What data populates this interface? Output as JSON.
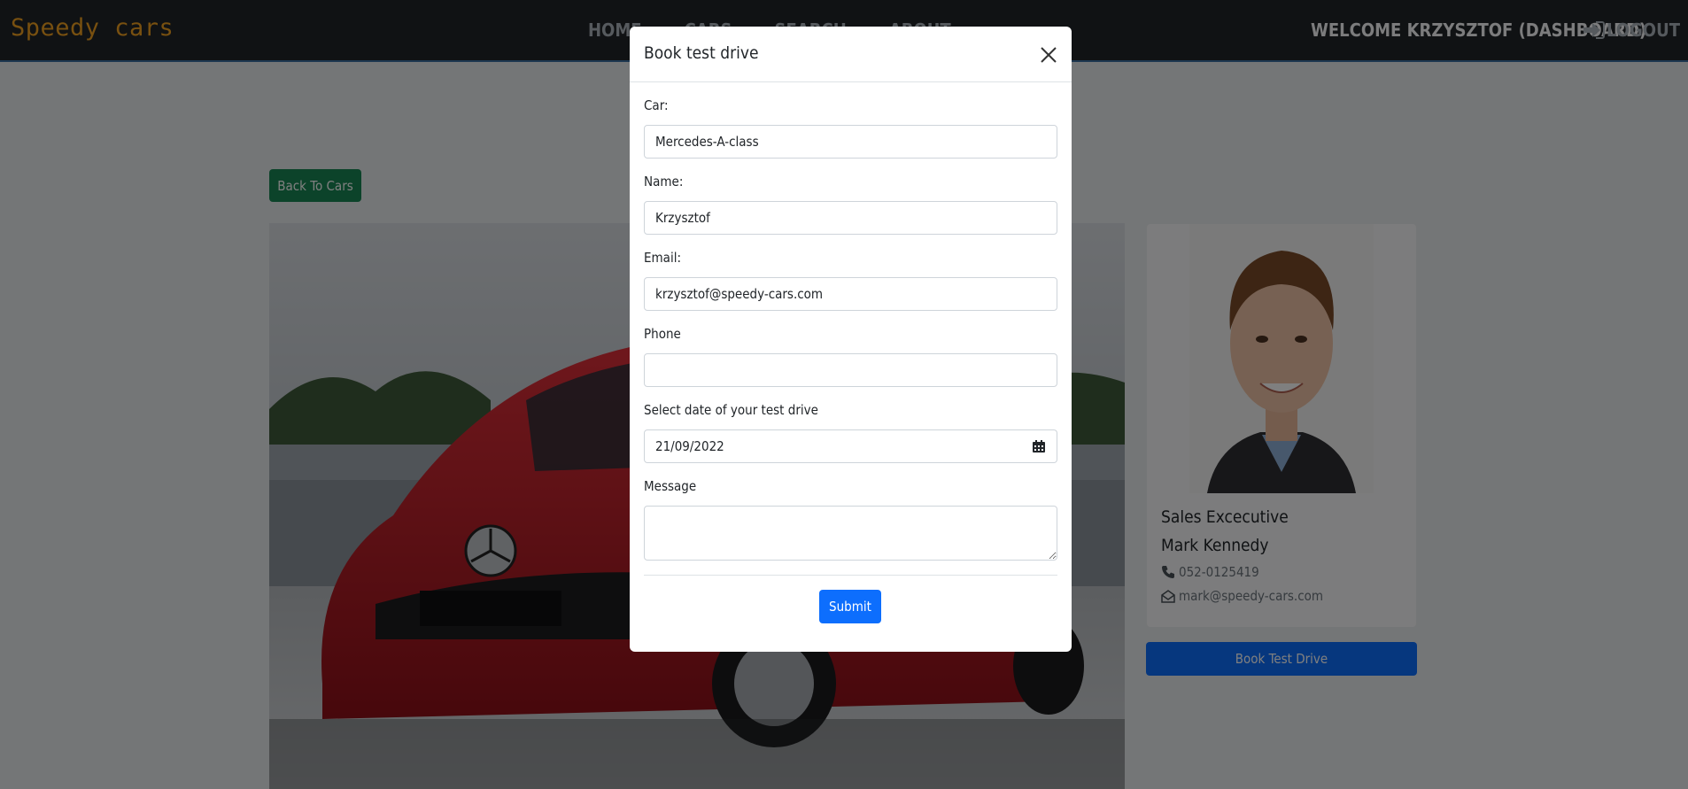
{
  "navbar": {
    "brand": "Speedy cars",
    "links": [
      "HOME",
      "CARS",
      "SEARCH",
      "ABOUT"
    ],
    "welcome": "WELCOME KRZYSZTOF (DASHBOARD)",
    "logout": "LOGOUT",
    "brand_color": "#f0a020"
  },
  "page": {
    "back_button": "Back To Cars",
    "agent": {
      "title": "Sales Excecutive",
      "name": "Mark Kennedy",
      "phone": "052-0125419",
      "email": "mark@speedy-cars.com"
    },
    "book_button": "Book Test Drive"
  },
  "modal": {
    "title": "Book test drive",
    "fields": {
      "car_label": "Car:",
      "car_value": "Mercedes-A-class",
      "name_label": "Name:",
      "name_value": "Krzysztof",
      "email_label": "Email:",
      "email_value": "krzysztof@speedy-cars.com",
      "phone_label": "Phone",
      "phone_value": "",
      "date_label": "Select date of your test drive",
      "date_value": "21/09/2022",
      "message_label": "Message",
      "message_value": ""
    },
    "submit": "Submit"
  },
  "colors": {
    "primary": "#0d6efd",
    "success": "#198754",
    "navbar_bg": "#212529"
  }
}
